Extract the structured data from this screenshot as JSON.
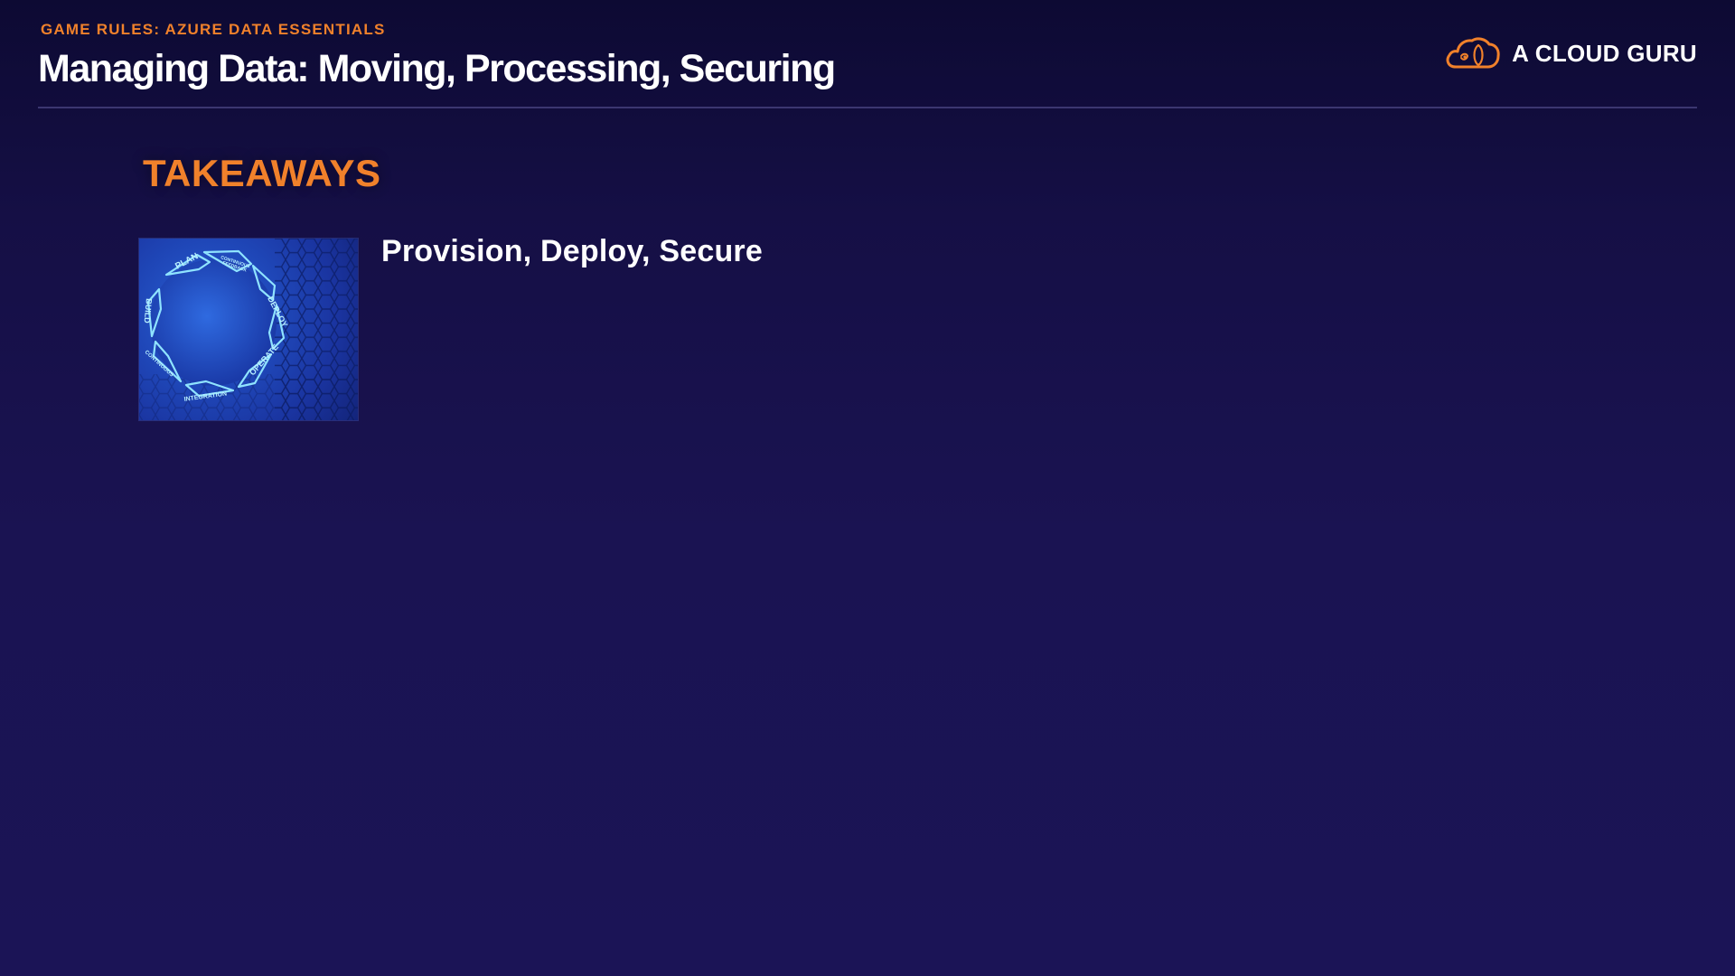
{
  "header": {
    "kicker": "GAME RULES: AZURE DATA ESSENTIALS",
    "title": "Managing Data: Moving, Processing, Securing"
  },
  "brand": {
    "name": "A CLOUD GURU",
    "logo_icon": "cloud-icon"
  },
  "section": {
    "heading": "TAKEAWAYS"
  },
  "takeaways": [
    {
      "image_icon": "devops-cycle-image",
      "image_labels": [
        "PLAN",
        "CONTINUOUS FEEDBACK",
        "DEPLOY",
        "OPERATE",
        "INTEGRATION",
        "CONTINUOUS",
        "BUILD"
      ],
      "text": "Provision, Deploy, Secure"
    }
  ],
  "colors": {
    "accent": "#f0812b",
    "background_top": "#0d0a33",
    "background_bottom": "#1b1456",
    "text": "#ffffff",
    "divider": "#3b3670"
  }
}
